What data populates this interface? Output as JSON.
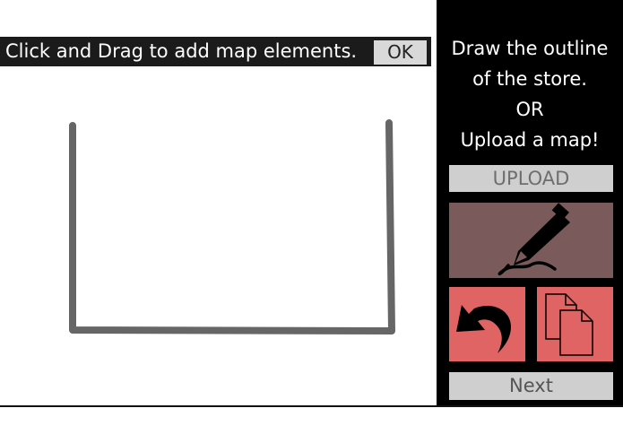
{
  "instruction": {
    "text": "Click and Drag to add map elements.",
    "ok_label": "OK"
  },
  "side_panel": {
    "prompt_lines": [
      "Draw the outline",
      "of the store.",
      "OR",
      "Upload a map!"
    ],
    "upload_label": "UPLOAD",
    "next_label": "Next",
    "tools": [
      {
        "name": "pen-tool",
        "icon": "pen-icon"
      },
      {
        "name": "undo",
        "icon": "undo-arrow-icon"
      },
      {
        "name": "copy",
        "icon": "copy-pages-icon"
      }
    ]
  },
  "colors": {
    "panel_bg": "#000000",
    "instruction_bg": "#1b1b1b",
    "button_gray": "#cfcfcf",
    "pen_tool_bg": "#7a5a5a",
    "action_red": "#e06464",
    "stroke_gray": "#666666"
  }
}
